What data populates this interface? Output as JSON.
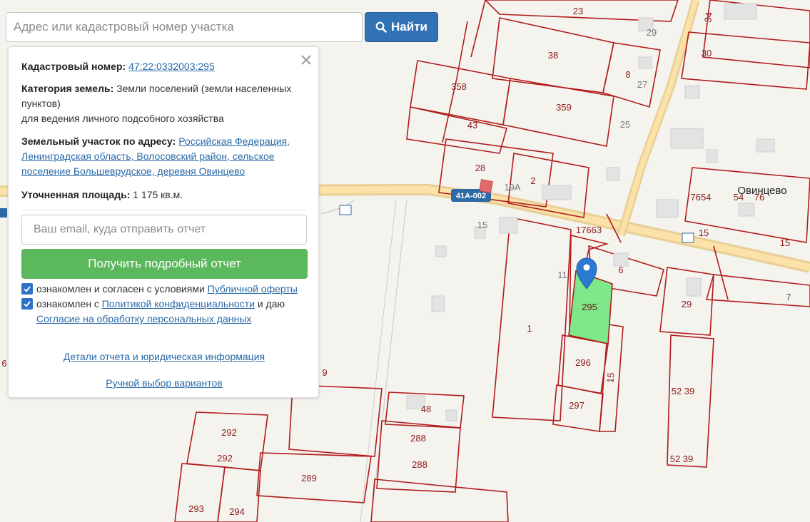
{
  "search": {
    "placeholder": "Адрес или кадастровый номер участка",
    "button_label": "Найти"
  },
  "panel": {
    "cadastral_label": "Кадастровый номер:",
    "cadastral_number": "47:22:0332003:295",
    "category_label": "Категория земель:",
    "category_value_1": "Земли поселений (земли населенных",
    "category_value_2": "пунктов)",
    "category_use": "для ведения личного подсобного хозяйства",
    "address_label": "Земельный участок по адресу:",
    "address_1": "Российская Федерация,",
    "address_2": "Ленинградская область, Волосовский район, сельское",
    "address_3": "поселение Большеврудское, деревня Овинцево",
    "area_label": "Уточненная площадь:",
    "area_value": "1 175 кв.м.",
    "email_placeholder": "Ваш email, куда отправить отчет",
    "get_report_button": "Получить подробный отчет",
    "consent1_text": "ознакомлен и согласен с условиями",
    "consent1_link": "Публичной оферты",
    "consent2_text": "ознакомлен с",
    "consent2_link": "Политикой конфиденциальности",
    "consent2_tail": "и даю",
    "consent2_link2": "Согласие на обработку персональных данных",
    "details_link": "Детали отчета и юридическая информация",
    "manual_link": "Ручной выбор вариантов"
  },
  "map": {
    "village_name": "Овинцево",
    "road_label": "41А-002",
    "selected_parcel": "295",
    "parcel_labels": [
      "23",
      "29",
      "34",
      "30",
      "38",
      "8",
      "27",
      "358",
      "359",
      "43",
      "25",
      "28",
      "19А",
      "2",
      "7654",
      "54",
      "76",
      "17663",
      "15",
      "15",
      "15",
      "11",
      "6",
      "1",
      "29",
      "7",
      "296",
      "15",
      "297",
      "52 39",
      "52 39",
      "48",
      "288",
      "288",
      "292",
      "292",
      "289",
      "293",
      "294",
      "9",
      "6"
    ],
    "colors": {
      "parcel_border": "#b01c1c",
      "selected_fill": "#7ee88a",
      "road": "#f5d48e",
      "marker": "#2a7ad1"
    }
  }
}
